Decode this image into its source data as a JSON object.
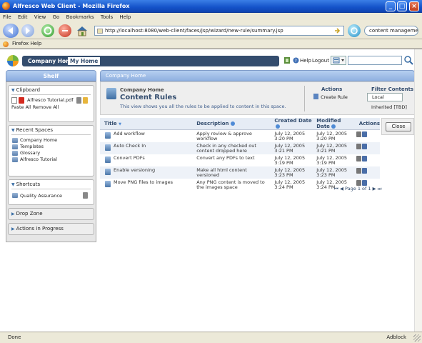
{
  "window": {
    "title": "Alfresco Web Client - Mozilla Firefox",
    "minimize": "_",
    "maximize": "□",
    "close": "×"
  },
  "menu": {
    "items": [
      "File",
      "Edit",
      "View",
      "Go",
      "Bookmarks",
      "Tools",
      "Help"
    ]
  },
  "toolbar": {
    "url": "http://localhost:8080/web-client/faces/jsp/wizard/new-rule/summary.jsp",
    "search_value": "content management"
  },
  "bookmarks": {
    "items": [
      "Firefox Help"
    ]
  },
  "header": {
    "company_home": "Company Home",
    "my_home": "My Home",
    "help": "Help",
    "logout": "Logout"
  },
  "shelf": {
    "title": "Shelf",
    "clipboard": {
      "label": "Clipboard",
      "file": "Alfresco Tutorial.pdf",
      "paste_all": "Paste All",
      "remove_all": "Remove All"
    },
    "recent_spaces": {
      "label": "Recent Spaces",
      "items": [
        "Company Home",
        "Templates",
        "Glossary",
        "Alfresco Tutorial"
      ]
    },
    "shortcuts": {
      "label": "Shortcuts",
      "items": [
        "Quality Assurance"
      ]
    },
    "drop_zone": "Drop Zone",
    "actions_in_progress": "Actions in Progress"
  },
  "main": {
    "breadcrumb": "Company Home",
    "space_name": "Company Home",
    "heading": "Content Rules",
    "description": "This view shows you all the rules to be applied to content in this space.",
    "actions_title": "Actions",
    "create_rule": "Create Rule",
    "filter_title": "Filter Contents",
    "filter_local": "Local",
    "filter_inherited": "Inherited [TBD]",
    "close_label": "Close"
  },
  "rules_table": {
    "columns": [
      "Title",
      "Description",
      "Created Date",
      "Modified Date",
      "Actions"
    ],
    "rows": [
      {
        "title": "Add workflow",
        "description": "Apply review & approve workflow",
        "created": "July 12, 2005 3:20 PM",
        "modified": "July 12, 2005 3:20 PM"
      },
      {
        "title": "Auto Check In",
        "description": "Check in any checked out content dropped here",
        "created": "July 12, 2005 3:21 PM",
        "modified": "July 12, 2005 3:21 PM"
      },
      {
        "title": "Convert PDFs",
        "description": "Convert any PDFs to text",
        "created": "July 12, 2005 3:19 PM",
        "modified": "July 12, 2005 3:19 PM"
      },
      {
        "title": "Enable versioning",
        "description": "Make all html content versioned",
        "created": "July 12, 2005 3:23 PM",
        "modified": "July 12, 2005 3:23 PM"
      },
      {
        "title": "Move PNG files to images",
        "description": "Any PNG content is moved to the images space",
        "created": "July 12, 2005 3:24 PM",
        "modified": "July 12, 2005 3:24 PM"
      }
    ],
    "pager_text": "Page 1 of 1"
  },
  "status": {
    "text": "Done",
    "adblock": "Adblock"
  },
  "colors": {
    "header_bg": "#344d6e",
    "panel_blue": "#8fb0e0",
    "xp_title": "#1452c9"
  }
}
